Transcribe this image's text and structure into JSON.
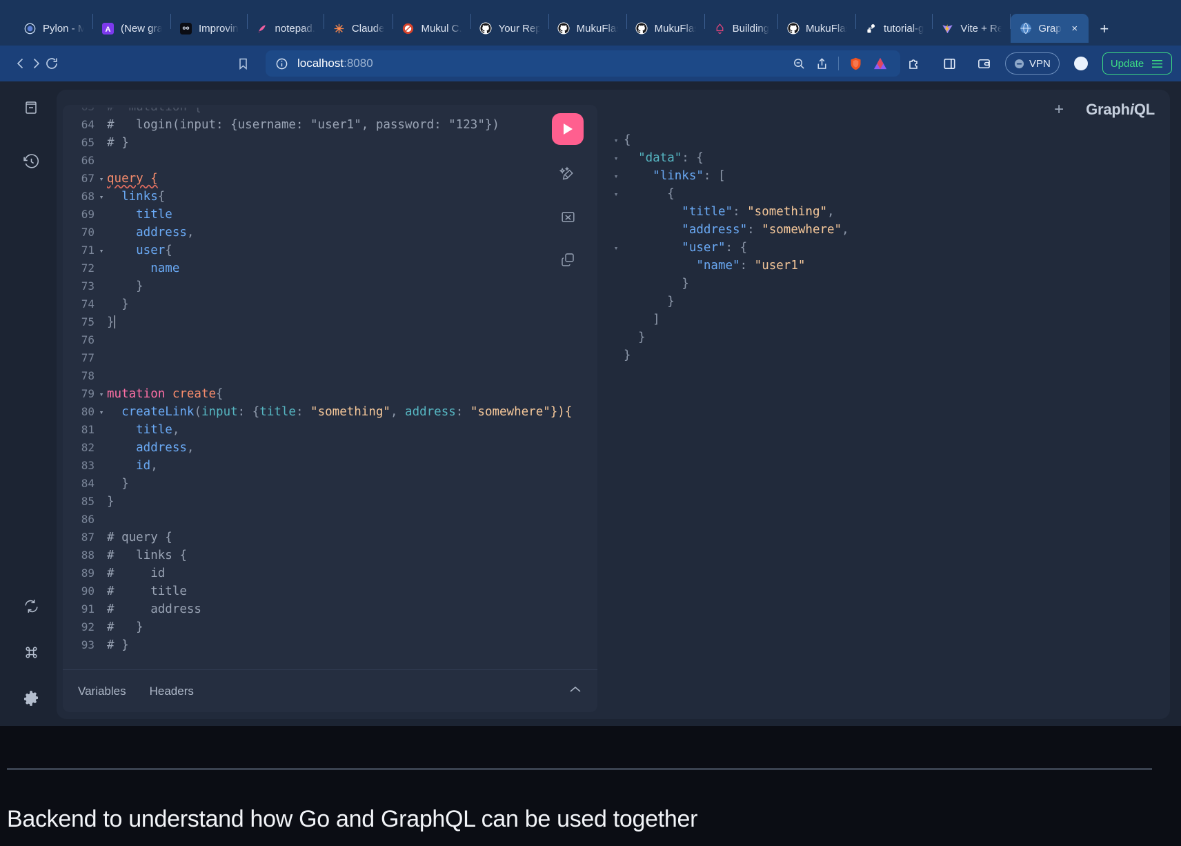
{
  "browser": {
    "tabs": [
      {
        "label": "Pylon - M",
        "icon": "pylon-icon",
        "active": false
      },
      {
        "label": "(New gra",
        "icon": "alation-icon",
        "active": false
      },
      {
        "label": "Improvin",
        "icon": "owl-icon",
        "active": false
      },
      {
        "label": "notepad.",
        "icon": "notepad-icon",
        "active": false
      },
      {
        "label": "Claude",
        "icon": "claude-icon",
        "active": false
      },
      {
        "label": "Mukul C.",
        "icon": "mukul-icon",
        "active": false
      },
      {
        "label": "Your Rep",
        "icon": "github-icon",
        "active": false
      },
      {
        "label": "MukuFlas",
        "icon": "github-icon",
        "active": false
      },
      {
        "label": "MukuFlas",
        "icon": "github-icon",
        "active": false
      },
      {
        "label": "Building",
        "icon": "bell-icon",
        "active": false
      },
      {
        "label": "MukuFlas",
        "icon": "github-icon",
        "active": false
      },
      {
        "label": "tutorial-g",
        "icon": "git-icon",
        "active": false
      },
      {
        "label": "Vite + Re",
        "icon": "vite-icon",
        "active": false
      },
      {
        "label": "Grap",
        "icon": "globe-icon",
        "active": true
      }
    ],
    "new_tab_label": "+",
    "tab_close_label": "×",
    "nav": {
      "back_label": "‹",
      "forward_label": "›",
      "reload_label": "reload-icon",
      "bookmark_label": "bookmark-icon"
    },
    "url": {
      "host": "localhost",
      "port": ":8080",
      "info_icon": "info-icon"
    },
    "toolbar": {
      "zoom_out_label": "zoom-out-icon",
      "share_label": "share-icon",
      "brave_label": "brave-shield-icon",
      "leo_label": "leo-ai-icon",
      "extensions_label": "extensions-icon",
      "sidebar_label": "sidebar-panel-icon",
      "wallet_label": "wallet-icon",
      "vpn_label": "VPN",
      "profile_label": "profile-icon",
      "update_label": "Update",
      "menu_label": "hamburger-menu-icon"
    },
    "colors": {
      "chrome": "#1b4079",
      "tabstrip": "#1a355c",
      "active_tab": "#27558f",
      "update_green": "#3ddc84"
    }
  },
  "graphiql": {
    "logo_prefix": "Graph",
    "logo_italic": "i",
    "logo_suffix": "QL",
    "add_tab_label": "+",
    "sidebar": [
      {
        "name": "docs-icon",
        "label": "Show Documentation Explorer"
      },
      {
        "name": "history-icon",
        "label": "Show History"
      },
      {
        "name": "refresh-icon",
        "label": "Re-fetch GraphQL schema"
      },
      {
        "name": "keyboard-shortcuts-icon",
        "label": "Open short keys dialog"
      },
      {
        "name": "settings-gear-icon",
        "label": "Open settings dialog"
      }
    ],
    "tools": [
      {
        "name": "execute-button",
        "label": "Execute query"
      },
      {
        "name": "prettify-icon",
        "label": "Prettify query"
      },
      {
        "name": "merge-icon",
        "label": "Merge fragments into query"
      },
      {
        "name": "copy-icon",
        "label": "Copy query"
      }
    ],
    "footer_tabs": [
      "Variables",
      "Headers"
    ],
    "footer_chevron": "∧",
    "colors": {
      "execute_pink": "#ff5f8f",
      "editor_bg": "#252e40",
      "panel_bg": "#212a3b"
    },
    "editor_lines": [
      {
        "n": 63,
        "fold": "",
        "parts": [
          {
            "t": "cmt",
            "s": "#  mutation {"
          }
        ],
        "clipped": true
      },
      {
        "n": 64,
        "fold": "",
        "parts": [
          {
            "t": "cmt",
            "s": "#   login(input: {username: \"user1\", password: \"123\"})"
          }
        ]
      },
      {
        "n": 65,
        "fold": "",
        "parts": [
          {
            "t": "cmt",
            "s": "# }"
          }
        ]
      },
      {
        "n": 66,
        "fold": "",
        "parts": []
      },
      {
        "n": 67,
        "fold": "▾",
        "parts": [
          {
            "t": "err",
            "s": "query {"
          }
        ],
        "caret": false
      },
      {
        "n": 68,
        "fold": "▾",
        "parts": [
          {
            "t": "fld",
            "s": "  links"
          },
          {
            "t": "pun",
            "s": "{"
          }
        ]
      },
      {
        "n": 69,
        "fold": "",
        "parts": [
          {
            "t": "fld",
            "s": "    title"
          }
        ]
      },
      {
        "n": 70,
        "fold": "",
        "parts": [
          {
            "t": "fld",
            "s": "    address"
          },
          {
            "t": "pun",
            "s": ","
          }
        ]
      },
      {
        "n": 71,
        "fold": "▾",
        "parts": [
          {
            "t": "fld",
            "s": "    user"
          },
          {
            "t": "pun",
            "s": "{"
          }
        ]
      },
      {
        "n": 72,
        "fold": "",
        "parts": [
          {
            "t": "fld",
            "s": "      name"
          }
        ]
      },
      {
        "n": 73,
        "fold": "",
        "parts": [
          {
            "t": "pun",
            "s": "    }"
          }
        ]
      },
      {
        "n": 74,
        "fold": "",
        "parts": [
          {
            "t": "pun",
            "s": "  }"
          }
        ]
      },
      {
        "n": 75,
        "fold": "",
        "parts": [
          {
            "t": "pun",
            "s": "}"
          }
        ],
        "caret": true
      },
      {
        "n": 76,
        "fold": "",
        "parts": []
      },
      {
        "n": 77,
        "fold": "",
        "parts": []
      },
      {
        "n": 78,
        "fold": "",
        "parts": []
      },
      {
        "n": 79,
        "fold": "▾",
        "parts": [
          {
            "t": "kw",
            "s": "mutation "
          },
          {
            "t": "nm",
            "s": "create"
          },
          {
            "t": "pun",
            "s": "{"
          }
        ]
      },
      {
        "n": 80,
        "fold": "▾",
        "parts": [
          {
            "t": "fld",
            "s": "  createLink"
          },
          {
            "t": "pun",
            "s": "("
          },
          {
            "t": "arg",
            "s": "input"
          },
          {
            "t": "pun",
            "s": ": {"
          },
          {
            "t": "arg",
            "s": "title"
          },
          {
            "t": "pun",
            "s": ": "
          },
          {
            "t": "str",
            "s": "\"something\""
          },
          {
            "t": "pun",
            "s": ", "
          },
          {
            "t": "arg",
            "s": "address"
          },
          {
            "t": "pun",
            "s": ": "
          },
          {
            "t": "str",
            "s": "\"somewhere\"}){"
          }
        ],
        "clipped": true
      },
      {
        "n": 81,
        "fold": "",
        "parts": [
          {
            "t": "fld",
            "s": "    title"
          },
          {
            "t": "pun",
            "s": ","
          }
        ]
      },
      {
        "n": 82,
        "fold": "",
        "parts": [
          {
            "t": "fld",
            "s": "    address"
          },
          {
            "t": "pun",
            "s": ","
          }
        ]
      },
      {
        "n": 83,
        "fold": "",
        "parts": [
          {
            "t": "fld",
            "s": "    id"
          },
          {
            "t": "pun",
            "s": ","
          }
        ]
      },
      {
        "n": 84,
        "fold": "",
        "parts": [
          {
            "t": "pun",
            "s": "  }"
          }
        ]
      },
      {
        "n": 85,
        "fold": "",
        "parts": [
          {
            "t": "pun",
            "s": "}"
          }
        ]
      },
      {
        "n": 86,
        "fold": "",
        "parts": []
      },
      {
        "n": 87,
        "fold": "",
        "parts": [
          {
            "t": "cmt",
            "s": "# query {"
          }
        ]
      },
      {
        "n": 88,
        "fold": "",
        "parts": [
          {
            "t": "cmt",
            "s": "#   links {"
          }
        ]
      },
      {
        "n": 89,
        "fold": "",
        "parts": [
          {
            "t": "cmt",
            "s": "#     id"
          }
        ]
      },
      {
        "n": 90,
        "fold": "",
        "parts": [
          {
            "t": "cmt",
            "s": "#     title"
          }
        ]
      },
      {
        "n": 91,
        "fold": "",
        "parts": [
          {
            "t": "cmt",
            "s": "#     address"
          }
        ]
      },
      {
        "n": 92,
        "fold": "",
        "parts": [
          {
            "t": "cmt",
            "s": "#   }"
          }
        ]
      },
      {
        "n": 93,
        "fold": "",
        "parts": [
          {
            "t": "cmt",
            "s": "# }"
          }
        ]
      }
    ],
    "response_lines": [
      {
        "fold": "▾",
        "parts": [
          {
            "t": "rpun",
            "s": "{"
          }
        ]
      },
      {
        "fold": "▾",
        "parts": [
          {
            "t": "rpun",
            "s": "  "
          },
          {
            "t": "rkey-top",
            "s": "\"data\""
          },
          {
            "t": "rpun",
            "s": ": {"
          }
        ]
      },
      {
        "fold": "▾",
        "parts": [
          {
            "t": "rpun",
            "s": "    "
          },
          {
            "t": "rkey",
            "s": "\"links\""
          },
          {
            "t": "rpun",
            "s": ": ["
          }
        ]
      },
      {
        "fold": "▾",
        "parts": [
          {
            "t": "rpun",
            "s": "      {"
          }
        ]
      },
      {
        "fold": "",
        "parts": [
          {
            "t": "rpun",
            "s": "        "
          },
          {
            "t": "rkey",
            "s": "\"title\""
          },
          {
            "t": "rpun",
            "s": ": "
          },
          {
            "t": "rstr",
            "s": "\"something\""
          },
          {
            "t": "rpun",
            "s": ","
          }
        ]
      },
      {
        "fold": "",
        "parts": [
          {
            "t": "rpun",
            "s": "        "
          },
          {
            "t": "rkey",
            "s": "\"address\""
          },
          {
            "t": "rpun",
            "s": ": "
          },
          {
            "t": "rstr",
            "s": "\"somewhere\""
          },
          {
            "t": "rpun",
            "s": ","
          }
        ]
      },
      {
        "fold": "▾",
        "parts": [
          {
            "t": "rpun",
            "s": "        "
          },
          {
            "t": "rkey",
            "s": "\"user\""
          },
          {
            "t": "rpun",
            "s": ": {"
          }
        ]
      },
      {
        "fold": "",
        "parts": [
          {
            "t": "rpun",
            "s": "          "
          },
          {
            "t": "rkey",
            "s": "\"name\""
          },
          {
            "t": "rpun",
            "s": ": "
          },
          {
            "t": "rstr",
            "s": "\"user1\""
          }
        ]
      },
      {
        "fold": "",
        "parts": [
          {
            "t": "rpun",
            "s": "        }"
          }
        ]
      },
      {
        "fold": "",
        "parts": [
          {
            "t": "rpun",
            "s": "      }"
          }
        ]
      },
      {
        "fold": "",
        "parts": [
          {
            "t": "rpun",
            "s": "    ]"
          }
        ]
      },
      {
        "fold": "",
        "parts": [
          {
            "t": "rpun",
            "s": "  }"
          }
        ]
      },
      {
        "fold": "",
        "parts": [
          {
            "t": "rpun",
            "s": "}"
          }
        ]
      }
    ]
  },
  "caption": {
    "text": "Backend to understand how Go and GraphQL can be used together"
  }
}
